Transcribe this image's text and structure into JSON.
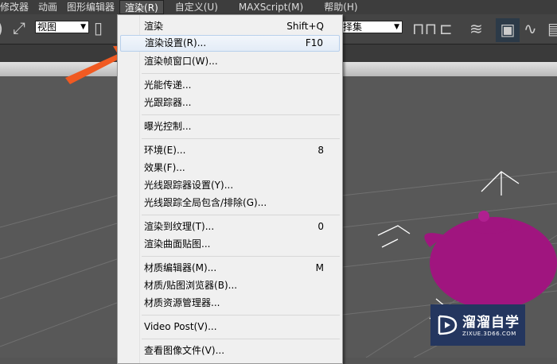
{
  "menubar": {
    "items": [
      "修改器",
      "动画",
      "图形编辑器",
      "渲染(R)",
      "自定义(U)",
      "MAXScript(M)",
      "帮助(H)"
    ]
  },
  "toolbar": {
    "view_select": "视图",
    "selection_set": "择集"
  },
  "render_menu": {
    "items": [
      {
        "label": "渲染",
        "shortcut": "Shift+Q"
      },
      {
        "label": "渲染设置(R)...",
        "shortcut": "F10"
      },
      {
        "label": "渲染帧窗口(W)...",
        "shortcut": ""
      },
      {
        "label": "光能传递...",
        "shortcut": ""
      },
      {
        "label": "光跟踪器...",
        "shortcut": ""
      },
      {
        "label": "曝光控制...",
        "shortcut": ""
      },
      {
        "label": "环境(E)...",
        "shortcut": "8"
      },
      {
        "label": "效果(F)...",
        "shortcut": ""
      },
      {
        "label": "光线跟踪器设置(Y)...",
        "shortcut": ""
      },
      {
        "label": "光线跟踪全局包含/排除(G)...",
        "shortcut": ""
      },
      {
        "label": "渲染到纹理(T)...",
        "shortcut": "0"
      },
      {
        "label": "渲染曲面贴图...",
        "shortcut": ""
      },
      {
        "label": "材质编辑器(M)...",
        "shortcut": "M"
      },
      {
        "label": "材质/贴图浏览器(B)...",
        "shortcut": ""
      },
      {
        "label": "材质资源管理器...",
        "shortcut": ""
      },
      {
        "label": "Video Post(V)...",
        "shortcut": ""
      },
      {
        "label": "查看图像文件(V)...",
        "shortcut": ""
      }
    ]
  },
  "watermark": {
    "title": "溜溜自学",
    "url": "ZIXUE.3D66.COM"
  },
  "colors": {
    "arrow": "#f05a22",
    "teapot": "#a0157f",
    "watermark_bg": "#24365f"
  }
}
